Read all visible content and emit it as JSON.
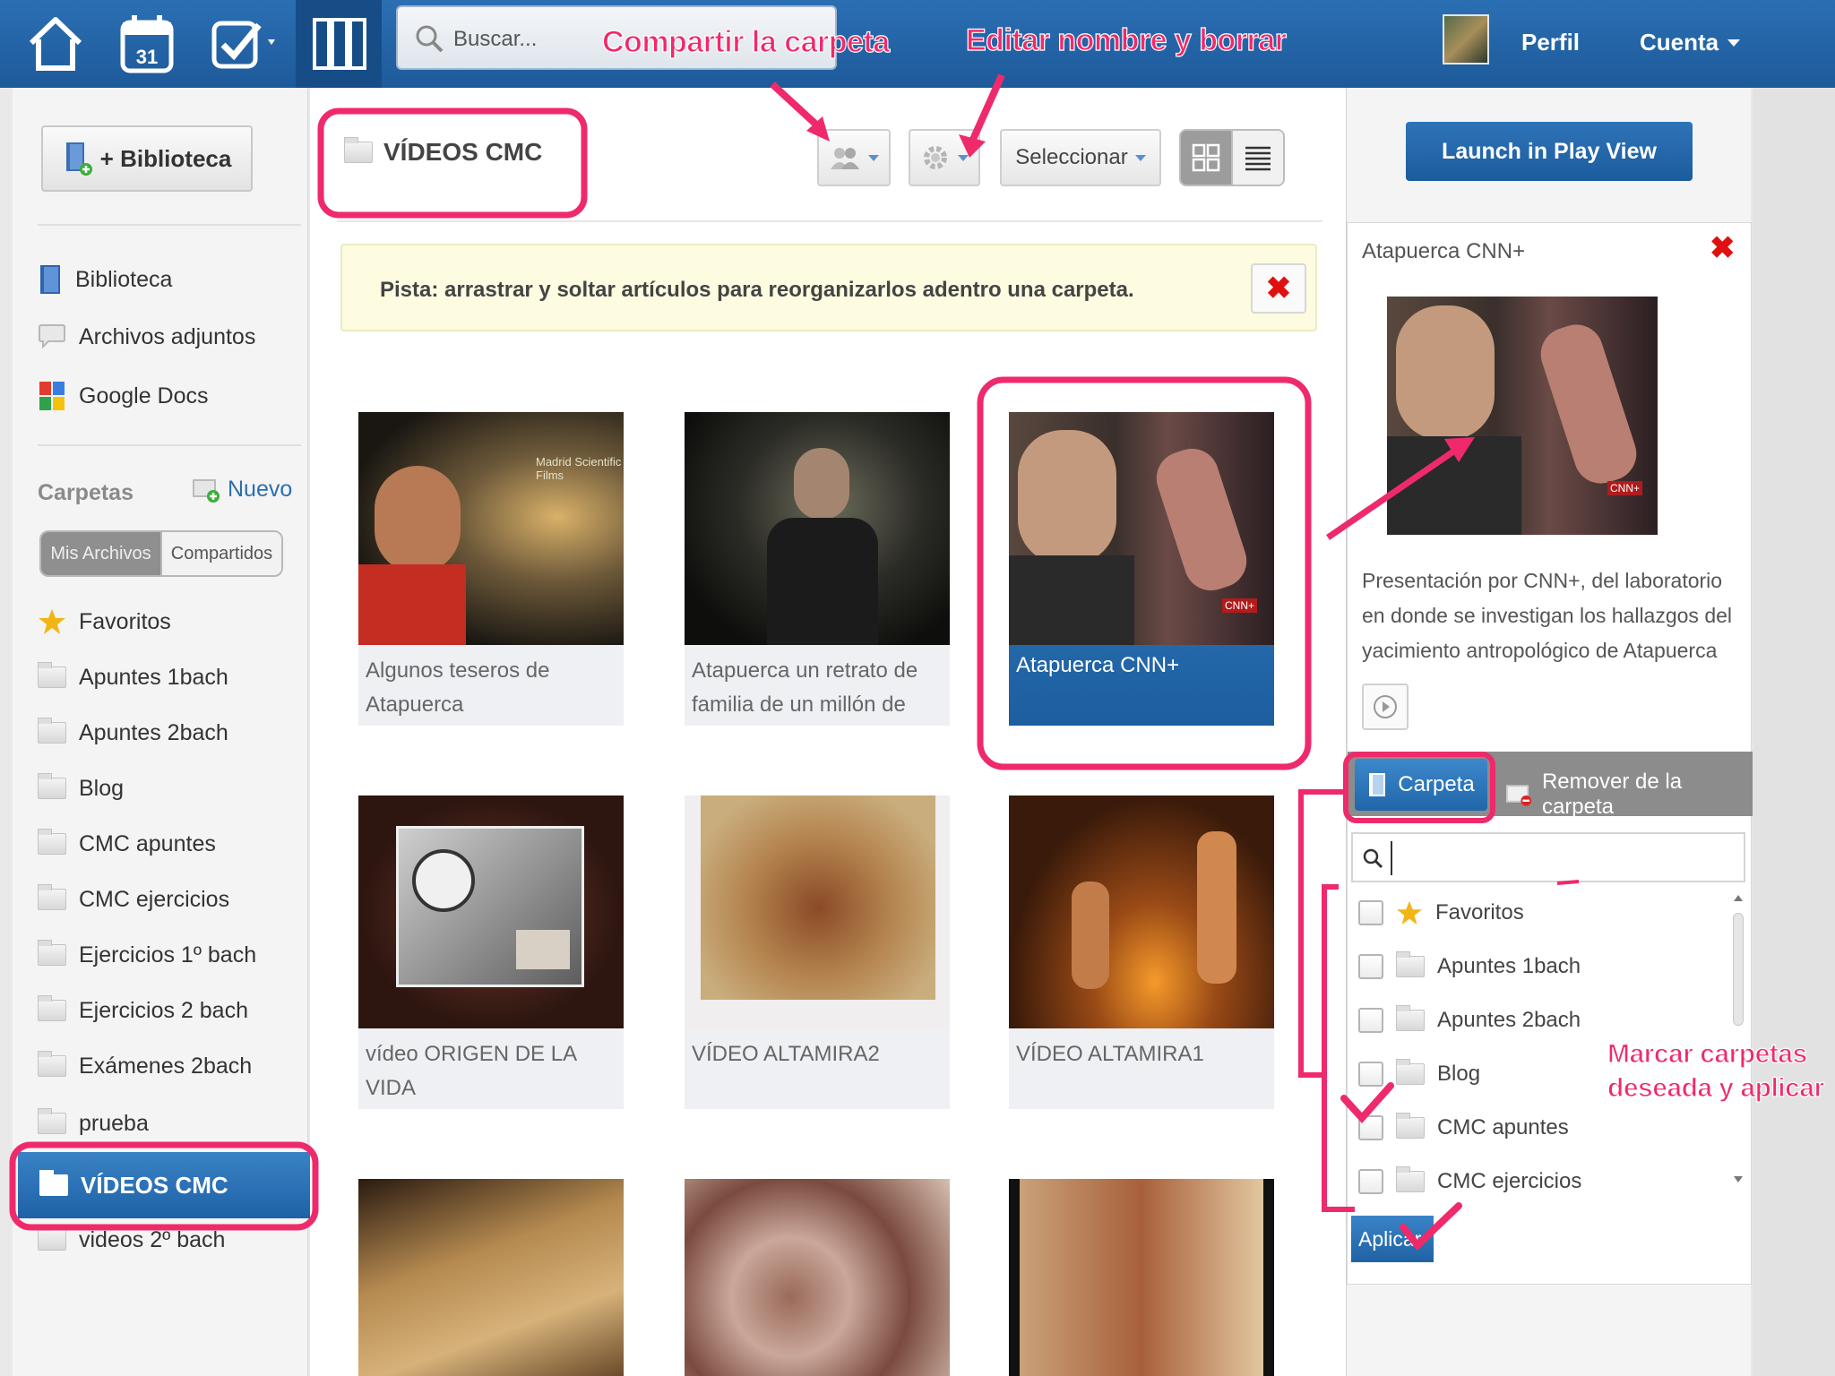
{
  "topbar": {
    "search_placeholder": "Buscar...",
    "profile_label": "Perfil",
    "account_label": "Cuenta",
    "icons": [
      "home-icon",
      "calendar-icon",
      "tasks-icon",
      "library-icon"
    ],
    "calendar_day": "31"
  },
  "sidebar": {
    "add_library_label": "+ Biblioteca",
    "nav": [
      {
        "label": "Biblioteca",
        "icon": "book-icon"
      },
      {
        "label": "Archivos adjuntos",
        "icon": "chat-bubble-icon"
      },
      {
        "label": "Google Docs",
        "icon": "google-icon"
      }
    ],
    "folders_heading": "Carpetas",
    "new_folder_label": "Nuevo",
    "segments": {
      "mine": "Mis Archivos",
      "shared": "Compartidos"
    },
    "folders": [
      {
        "label": "Favoritos",
        "icon": "star-icon"
      },
      {
        "label": "Apuntes 1bach",
        "icon": "folder-icon"
      },
      {
        "label": "Apuntes 2bach",
        "icon": "folder-icon"
      },
      {
        "label": "Blog",
        "icon": "folder-icon"
      },
      {
        "label": "CMC apuntes",
        "icon": "folder-icon"
      },
      {
        "label": "CMC ejercicios",
        "icon": "folder-icon"
      },
      {
        "label": "Ejercicios 1º bach",
        "icon": "folder-icon"
      },
      {
        "label": "Ejercicios 2 bach",
        "icon": "folder-icon"
      },
      {
        "label": "Exámenes 2bach",
        "icon": "folder-icon"
      },
      {
        "label": "prueba",
        "icon": "folder-icon"
      }
    ],
    "active_folder": "VÍDEOS CMC",
    "next_folder": "videos 2º bach"
  },
  "main": {
    "folder_title": "VÍDEOS CMC",
    "select_label": "Seleccionar",
    "hint": "Pista: arrastrar y soltar artículos para reorganizarlos adentro una carpeta.",
    "cards": [
      {
        "caption": "Algunos teseros de Atapuerca"
      },
      {
        "caption": "Atapuerca un retrato de familia de un millón de"
      },
      {
        "caption": "Atapuerca CNN+",
        "selected": true
      },
      {
        "caption": "vídeo ORIGEN DE LA VIDA"
      },
      {
        "caption": "VÍDEO ALTAMIRA2"
      },
      {
        "caption": "VÍDEO ALTAMIRA1"
      },
      {
        "caption": ""
      },
      {
        "caption": ""
      },
      {
        "caption": ""
      }
    ],
    "thumb_overlay_text": "Madrid Scientific Films",
    "cnn_badge": "CNN+"
  },
  "right_panel": {
    "launch_label": "Launch in Play View",
    "detail_title": "Atapuerca CNN+",
    "description": "Presentación por CNN+, del laboratorio en donde se investigan los hallazgos del yacimiento antropológico de Atapuerca",
    "tab_folder": "Carpeta",
    "tab_remove": "Remover de la carpeta",
    "folder_options": [
      {
        "label": "Favoritos",
        "icon": "star-icon"
      },
      {
        "label": "Apuntes 1bach",
        "icon": "folder-icon"
      },
      {
        "label": "Apuntes 2bach",
        "icon": "folder-icon"
      },
      {
        "label": "Blog",
        "icon": "folder-icon"
      },
      {
        "label": "CMC apuntes",
        "icon": "folder-icon"
      },
      {
        "label": "CMC ejercicios",
        "icon": "folder-icon"
      }
    ],
    "apply_label": "Aplicar"
  },
  "annotations": {
    "share_folder": "Compartir la carpeta",
    "edit_delete": "Editar nombre y borrar",
    "mark_line1": "Marcar carpetas",
    "mark_line2": "deseada y aplicar"
  },
  "colors": {
    "topbar": "#1d5a9a",
    "accent": "#2067aa",
    "annotation": "#ef2a6b",
    "hint_bg": "#fdfbe0"
  }
}
